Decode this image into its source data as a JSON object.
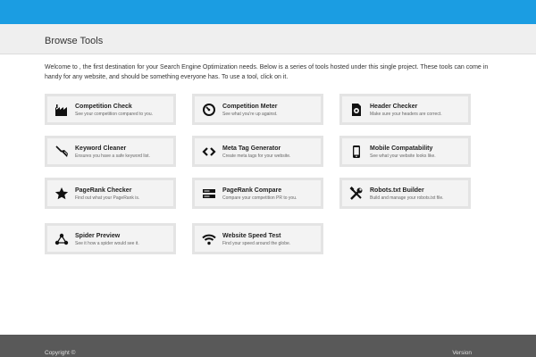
{
  "header": {
    "title": "Browse Tools"
  },
  "intro": "Welcome to , the first destination for your Search Engine Optimization needs. Below is a series of tools hosted under this single project. These tools can come in handy for any website, and should be something everyone has. To use a tool, click on it.",
  "tools": [
    {
      "name": "Competition Check",
      "desc": "See your competition compared to you.",
      "icon": "factory-icon"
    },
    {
      "name": "Competition Meter",
      "desc": "See what you're up against.",
      "icon": "gauge-icon"
    },
    {
      "name": "Header Checker",
      "desc": "Make sure your headers are correct.",
      "icon": "document-gear-icon"
    },
    {
      "name": "Keyword Cleaner",
      "desc": "Ensures you have a safe keyword list.",
      "icon": "broom-icon"
    },
    {
      "name": "Meta Tag Generator",
      "desc": "Create meta tags for your website.",
      "icon": "code-tag-icon"
    },
    {
      "name": "Mobile Compatability",
      "desc": "See what your website looks like.",
      "icon": "mobile-phone-icon"
    },
    {
      "name": "PageRank Checker",
      "desc": "Find out what your PageRank is.",
      "icon": "star-icon"
    },
    {
      "name": "PageRank Compare",
      "desc": "Compare your competition PR to you.",
      "icon": "server-icon"
    },
    {
      "name": "Robots.txt Builder",
      "desc": "Build and manage your robots.txt file.",
      "icon": "tools-icon"
    },
    {
      "name": "Spider Preview",
      "desc": "See it how a spider would see it.",
      "icon": "network-icon"
    },
    {
      "name": "Website Speed Test",
      "desc": "Find your speed around the globe.",
      "icon": "wifi-icon"
    }
  ],
  "footer": {
    "copyright": "Copyright ©",
    "version": "Version"
  },
  "colors": {
    "topbar": "#1b9de2",
    "footer": "#595959"
  }
}
